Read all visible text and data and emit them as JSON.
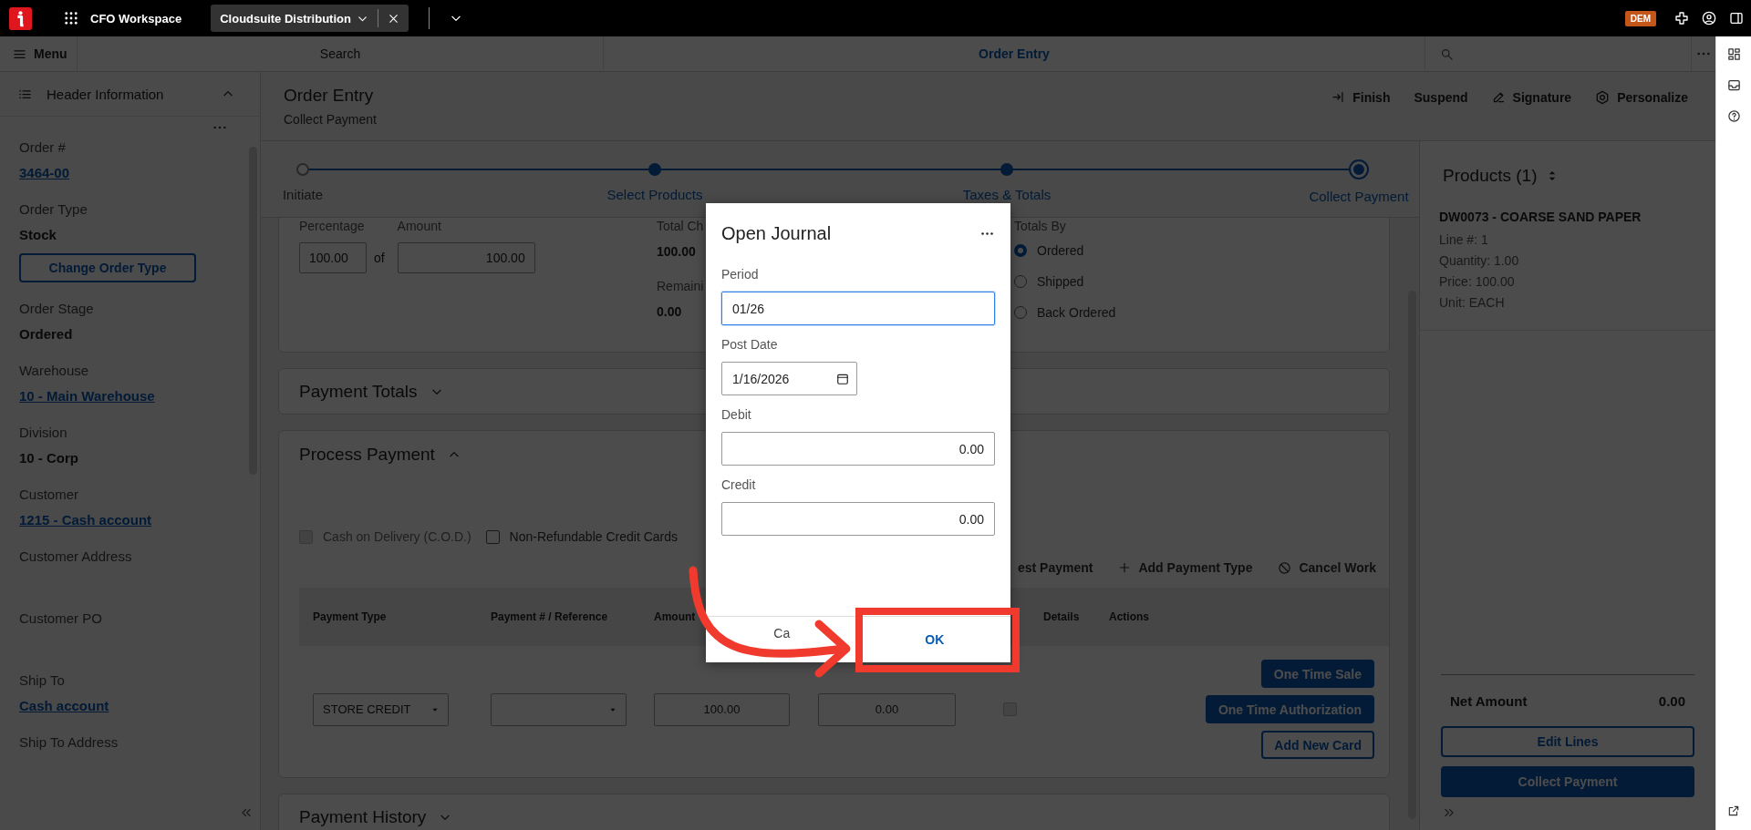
{
  "top_bar": {
    "app_name": "CFO Workspace",
    "tabs": [
      {
        "label": "Cloudsuite Distribution",
        "selected": true
      }
    ],
    "badge": "DEM"
  },
  "nav_bar": {
    "menu": "Menu",
    "search_tab": "Search",
    "tabs": [
      {
        "label": "Order Entry",
        "selected": true
      }
    ]
  },
  "sidebar": {
    "title": "Header Information",
    "expanded": true,
    "fields": [
      {
        "kind": "link",
        "label": "Order #",
        "value": "3464-00"
      },
      {
        "kind": "text",
        "label": "Order Type",
        "value": "Stock"
      },
      {
        "kind": "button",
        "label": "Change Order Type"
      },
      {
        "kind": "text",
        "label": "Order Stage",
        "value": "Ordered"
      },
      {
        "kind": "link",
        "label": "Warehouse",
        "value": "10 - Main Warehouse"
      },
      {
        "kind": "text",
        "label": "Division",
        "value": "10 - Corp"
      },
      {
        "kind": "link",
        "label": "Customer",
        "value": "1215 - Cash account"
      },
      {
        "kind": "text",
        "label": "Customer Address"
      },
      {
        "kind": "text",
        "label": "Customer PO"
      },
      {
        "kind": "link",
        "label": "Ship To",
        "value": "Cash account"
      },
      {
        "kind": "text",
        "label": "Ship To Address"
      }
    ]
  },
  "page": {
    "title": "Order Entry",
    "subtitle": "Collect Payment",
    "actions": [
      {
        "label": "Finish"
      },
      {
        "label": "Suspend"
      },
      {
        "label": "Signature"
      },
      {
        "label": "Personalize"
      }
    ]
  },
  "stepper": {
    "steps": [
      {
        "label": "Initiate",
        "completed": false,
        "selected": false
      },
      {
        "label": "Select Products",
        "completed": true,
        "selected": false
      },
      {
        "label": "Taxes & Totals",
        "completed": true,
        "selected": false
      },
      {
        "label": "Collect Payment",
        "completed": true,
        "selected": true
      }
    ]
  },
  "split": {
    "percentage_label": "Percentage",
    "percentage": "100.00",
    "of": "of",
    "amount_label": "Amount",
    "amount": "100.00",
    "total_label": "Total Ch",
    "total": "100.00",
    "remaining_label": "Remaini",
    "remaining": "0.00",
    "totals_by": {
      "label": "Totals By",
      "options": [
        {
          "label": "Ordered",
          "selected": true
        },
        {
          "label": "Shipped",
          "selected": false
        },
        {
          "label": "Back Ordered",
          "selected": false
        }
      ]
    }
  },
  "payment_totals": {
    "title": "Payment Totals",
    "expanded": false
  },
  "process_payment": {
    "title": "Process Payment",
    "expanded": true,
    "checkboxes": [
      {
        "label": "Cash on Delivery (C.O.D.)",
        "checked": false,
        "disabled": true
      },
      {
        "label": "Non-Refundable Credit Cards",
        "checked": false,
        "disabled": false
      }
    ],
    "actions": [
      "est Payment",
      "Add Payment Type",
      "Cancel Work"
    ],
    "columns": [
      "Payment Type",
      "Payment # / Reference",
      "Amount",
      "Details",
      "Actions"
    ],
    "rows": [
      {
        "payment_type": "STORE CREDIT",
        "amount": "100.00",
        "column_4": "0.00",
        "details_checked": false,
        "buttons": [
          {
            "label": "One Time Sale",
            "kind": "primary"
          },
          {
            "label": "One Time Authorization",
            "kind": "primary"
          },
          {
            "label": "Add New Card",
            "kind": "outline"
          }
        ]
      }
    ]
  },
  "payment_history": {
    "title": "Payment History",
    "expanded": false
  },
  "products": {
    "title": "Products (1)",
    "items": [
      {
        "name": "DW0073 - COARSE SAND PAPER",
        "details": [
          "Line #: 1",
          "Quantity: 1.00",
          "Price: 100.00",
          "Unit: EACH"
        ]
      }
    ],
    "net_label": "Net Amount",
    "net": "0.00",
    "buttons": [
      {
        "label": "Edit Lines",
        "kind": "outline"
      },
      {
        "label": "Collect Payment",
        "kind": "primary"
      }
    ]
  },
  "dialog": {
    "title": "Open Journal",
    "fields": [
      {
        "label": "Period",
        "value": "01/26",
        "kind": "text",
        "focused": true
      },
      {
        "label": "Post Date",
        "value": "1/16/2026",
        "kind": "date",
        "focused": false
      },
      {
        "label": "Debit",
        "value": "0.00",
        "kind": "number",
        "focused": false
      },
      {
        "label": "Credit",
        "value": "0.00",
        "kind": "number",
        "focused": false
      }
    ],
    "buttons": [
      {
        "label": "Ca"
      },
      {
        "label": "OK"
      }
    ]
  }
}
